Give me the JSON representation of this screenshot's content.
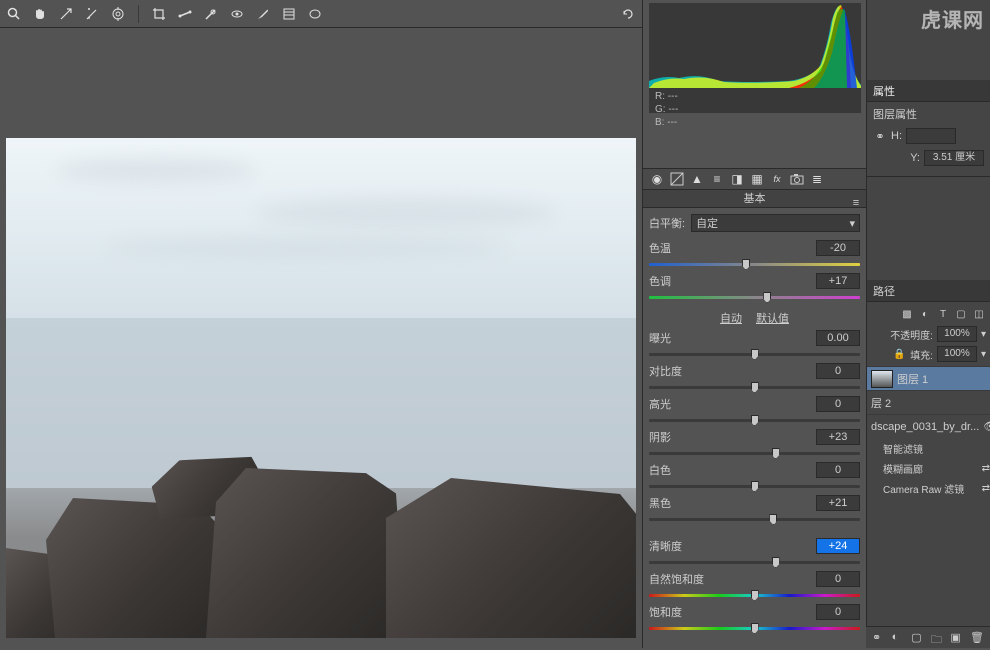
{
  "watermark": "虎课网",
  "rgb": {
    "r_label": "R:",
    "g_label": "G:",
    "b_label": "B:",
    "r": "---",
    "g": "---",
    "b": "---"
  },
  "acr": {
    "panel_title": "基本",
    "wb_label": "白平衡:",
    "wb_value": "自定",
    "auto_label": "自动",
    "default_label": "默认值",
    "sliders": {
      "temp": {
        "label": "色温",
        "value": "-20",
        "pos": 46
      },
      "tint": {
        "label": "色调",
        "value": "+17",
        "pos": 56
      },
      "exposure": {
        "label": "曝光",
        "value": "0.00",
        "pos": 50
      },
      "contrast": {
        "label": "对比度",
        "value": "0",
        "pos": 50
      },
      "highlights": {
        "label": "高光",
        "value": "0",
        "pos": 50
      },
      "shadows": {
        "label": "阴影",
        "value": "+23",
        "pos": 60
      },
      "whites": {
        "label": "白色",
        "value": "0",
        "pos": 50
      },
      "blacks": {
        "label": "黑色",
        "value": "+21",
        "pos": 59
      },
      "clarity": {
        "label": "清晰度",
        "value": "+24",
        "pos": 60
      },
      "vibrance": {
        "label": "自然饱和度",
        "value": "0",
        "pos": 50
      },
      "saturation": {
        "label": "饱和度",
        "value": "0",
        "pos": 50
      }
    }
  },
  "props": {
    "tab1": "属性",
    "tab2": "图层属性",
    "h_label": "H:",
    "h_value": "",
    "y_label": "Y:",
    "y_value": "3.51 厘米"
  },
  "paths_tab": "路径",
  "layers": {
    "opacity_label": "不透明度:",
    "opacity_value": "100%",
    "fill_label": "填充:",
    "fill_value": "100%",
    "items": [
      {
        "name": "图层 1"
      },
      {
        "name": "层 2"
      },
      {
        "name": "dscape_0031_by_dr..."
      }
    ],
    "smart_filters": "智能滤镜",
    "filter1": "模糊画廊",
    "filter2": "Camera Raw 滤镜"
  }
}
